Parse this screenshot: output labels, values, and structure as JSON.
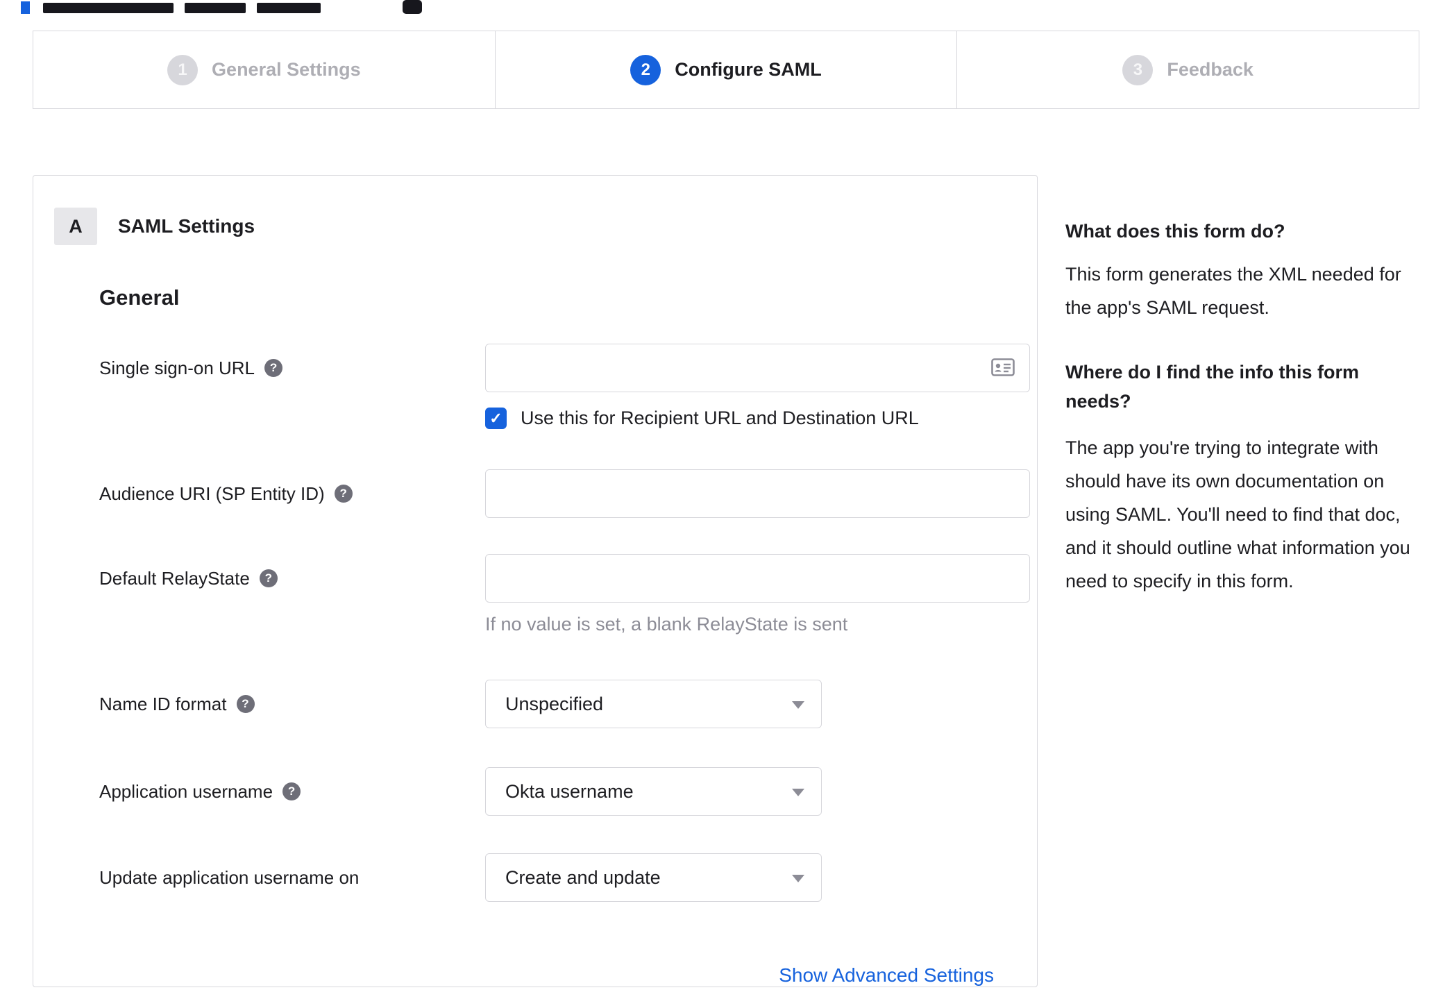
{
  "stepper": {
    "steps": [
      {
        "number": "1",
        "label": "General Settings",
        "state": "inactive"
      },
      {
        "number": "2",
        "label": "Configure SAML",
        "state": "active"
      },
      {
        "number": "3",
        "label": "Feedback",
        "state": "inactive"
      }
    ]
  },
  "panel": {
    "badge": "A",
    "title": "SAML Settings",
    "section_title": "General",
    "fields": {
      "sso": {
        "label": "Single sign-on URL",
        "value": "",
        "checkbox_label": "Use this for Recipient URL and Destination URL",
        "checked": true,
        "check_glyph": "✓"
      },
      "audience": {
        "label": "Audience URI (SP Entity ID)",
        "value": ""
      },
      "relay": {
        "label": "Default RelayState",
        "value": "",
        "helper": "If no value is set, a blank RelayState is sent"
      },
      "nameid": {
        "label": "Name ID format",
        "selected": "Unspecified"
      },
      "appuser": {
        "label": "Application username",
        "selected": "Okta username"
      },
      "updateuser": {
        "label": "Update application username on",
        "selected": "Create and update"
      }
    },
    "advanced_link_label": "Show Advanced Settings",
    "help_glyph": "?"
  },
  "sidebar": {
    "q1": "What does this form do?",
    "a1": "This form generates the XML needed for the app's SAML request.",
    "q2": "Where do I find the info this form needs?",
    "a2": "The app you're trying to integrate with should have its own documentation on using SAML. You'll need to find that doc, and it should outline what information you need to specify in this form."
  },
  "colors": {
    "accent": "#1662dd",
    "border": "#d7d7dc",
    "muted": "#8c8c96"
  }
}
